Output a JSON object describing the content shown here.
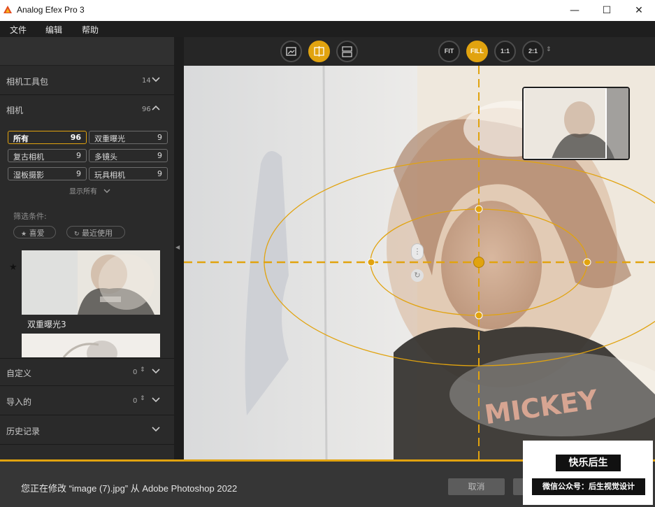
{
  "window": {
    "title": "Analog Efex Pro 3",
    "minimize_glyph": "—",
    "maximize_glyph": "☐",
    "close_glyph": "✕"
  },
  "menu": {
    "items": [
      "文件",
      "编辑",
      "帮助"
    ]
  },
  "sidebar": {
    "sections_top": [
      {
        "label": "相机工具包",
        "count": "14",
        "expanded": false
      },
      {
        "label": "相机",
        "count": "96",
        "expanded": true
      }
    ],
    "cameras": [
      {
        "label": "所有",
        "count": "96",
        "active": true
      },
      {
        "label": "双重曝光",
        "count": "9",
        "active": false
      },
      {
        "label": "复古相机",
        "count": "9",
        "active": false
      },
      {
        "label": "多镜头",
        "count": "9",
        "active": false
      },
      {
        "label": "湿板摄影",
        "count": "9",
        "active": false
      },
      {
        "label": "玩具相机",
        "count": "9",
        "active": false
      }
    ],
    "show_all": "显示所有",
    "filter_label": "筛选条件:",
    "filters": [
      {
        "icon": "star-icon",
        "label": "喜爱"
      },
      {
        "icon": "history-icon",
        "label": "最近使用"
      }
    ],
    "preset": {
      "name": "双重曝光3",
      "favorite": true
    },
    "sections_bottom": [
      {
        "label": "自定义",
        "count": "0"
      },
      {
        "label": "导入的",
        "count": "0"
      },
      {
        "label": "历史记录",
        "count": ""
      }
    ]
  },
  "toolbar": {
    "zoom": [
      "FIT",
      "FILL",
      "1:1",
      "2:1"
    ],
    "active_zoom": "FILL"
  },
  "canvas": {
    "shirt_text": "MICKEY"
  },
  "status": {
    "message": "您正在修改 “image (7).jpg” 从 Adobe Photoshop 2022",
    "cancel_label": "取消"
  },
  "watermark": {
    "title": "快乐后生",
    "subtitle": "微信公众号：后生视觉设计"
  },
  "colors": {
    "accent": "#e1a30f",
    "panel": "#2a2a2a",
    "statusbar": "#363636"
  }
}
